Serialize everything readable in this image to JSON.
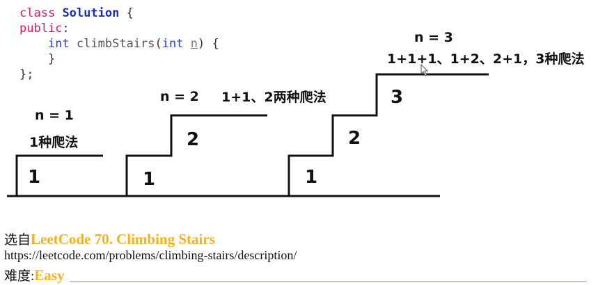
{
  "code": {
    "line1_kw": "class",
    "line1_name": "Solution",
    "line1_brace": "{",
    "line2_kw": "public",
    "line2_colon": ":",
    "line3_type": "int",
    "line3_fn": "climbStairs",
    "line3_paren_open": "(",
    "line3_ptype": "int",
    "line3_param": "n",
    "line3_rest": ") {",
    "line4": "}",
    "line5": "};"
  },
  "diagrams": [
    {
      "title": "n = 1",
      "caption": "1种爬法",
      "steps": [
        "1"
      ]
    },
    {
      "title": "n = 2",
      "caption": "1+1、2两种爬法",
      "steps": [
        "1",
        "2"
      ]
    },
    {
      "title": "n = 3",
      "caption": "1+1+1、1+2、2+1，3种爬法",
      "steps": [
        "1",
        "2",
        "3"
      ]
    }
  ],
  "footer": {
    "prefix": "选自",
    "problem": "LeetCode 70. Climbing Stairs",
    "url": "https://leetcode.com/problems/climbing-stairs/description/",
    "difficulty_label": "难度:",
    "difficulty": "Easy"
  },
  "colors": {
    "keyword": "#d81b60",
    "type": "#1e3fd8",
    "highlight": "#f7b21a",
    "line": "#111111"
  }
}
